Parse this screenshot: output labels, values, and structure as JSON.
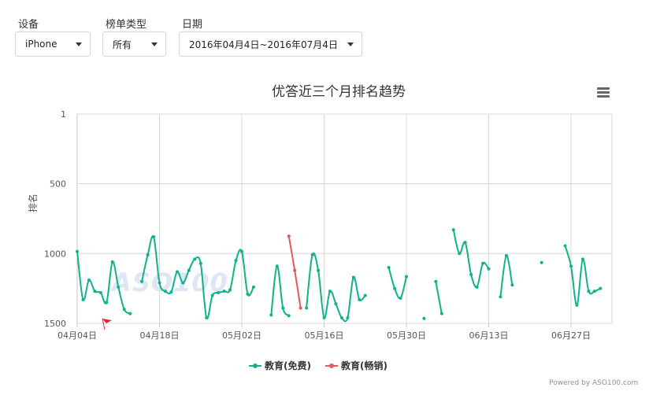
{
  "filters": {
    "device": {
      "label": "设备",
      "value": "iPhone"
    },
    "chart_type": {
      "label": "榜单类型",
      "value": "所有"
    },
    "date": {
      "label": "日期",
      "value": "2016年04月4日~2016年07月4日"
    }
  },
  "watermark": "ASO100",
  "credits": "Powered by ASO100.com",
  "colors": {
    "series_free": "#0fb389",
    "series_paid": "#e8565a",
    "grid": "#d8d8d8"
  },
  "chart_data": {
    "type": "line",
    "title": "优答近三个月排名趋势",
    "ylabel": "排名",
    "y_reversed": true,
    "ylim": [
      1,
      1500
    ],
    "yticks": [
      "1",
      "500",
      "1000",
      "1500"
    ],
    "xticks": [
      "04月04日",
      "04月18日",
      "05月02日",
      "05月16日",
      "05月30日",
      "06月13日",
      "06月27日"
    ],
    "x_start": "04月04日",
    "x_end": "07月04日",
    "grid": true,
    "legend_position": "bottom",
    "series": [
      {
        "name": "教育(免费)",
        "color": "#0fb389",
        "segments": [
          [
            [
              0,
              985
            ],
            [
              1,
              1330
            ],
            [
              2,
              1190
            ],
            [
              3,
              1270
            ],
            [
              4,
              1280
            ],
            [
              5,
              1350
            ],
            [
              6,
              1060
            ],
            [
              7,
              1240
            ],
            [
              8,
              1400
            ],
            [
              9,
              1430
            ]
          ],
          [
            [
              11,
              1200
            ],
            [
              12,
              1010
            ],
            [
              13,
              880
            ],
            [
              14,
              1210
            ],
            [
              15,
              1270
            ],
            [
              16,
              1275
            ],
            [
              17,
              1130
            ],
            [
              18,
              1210
            ],
            [
              19,
              1120
            ],
            [
              20,
              1040
            ],
            [
              21,
              1070
            ],
            [
              22,
              1460
            ],
            [
              23,
              1300
            ],
            [
              24,
              1280
            ],
            [
              25,
              1270
            ],
            [
              26,
              1260
            ],
            [
              27,
              1050
            ],
            [
              28,
              985
            ],
            [
              29,
              1290
            ],
            [
              30,
              1240
            ]
          ],
          [
            [
              33,
              1440
            ],
            [
              34,
              1090
            ],
            [
              35,
              1390
            ],
            [
              36,
              1445
            ]
          ],
          [
            [
              39,
              1390
            ],
            [
              40,
              1010
            ],
            [
              41,
              1120
            ],
            [
              42,
              1460
            ],
            [
              43,
              1270
            ],
            [
              44,
              1360
            ],
            [
              45,
              1460
            ],
            [
              46,
              1460
            ],
            [
              47,
              1170
            ],
            [
              48,
              1330
            ],
            [
              49,
              1300
            ]
          ],
          [
            [
              53,
              1100
            ],
            [
              54,
              1250
            ],
            [
              55,
              1320
            ],
            [
              56,
              1165
            ]
          ],
          [
            [
              59,
              1465
            ]
          ],
          [
            [
              61,
              1200
            ],
            [
              62,
              1430
            ]
          ],
          [
            [
              64,
              830
            ],
            [
              65,
              1000
            ],
            [
              66,
              920
            ],
            [
              67,
              1150
            ],
            [
              68,
              1240
            ],
            [
              69,
              1070
            ],
            [
              70,
              1110
            ]
          ],
          [
            [
              72,
              1310
            ],
            [
              73,
              1015
            ],
            [
              74,
              1225
            ]
          ],
          [
            [
              79,
              1065
            ]
          ],
          [
            [
              83,
              945
            ],
            [
              84,
              1090
            ],
            [
              85,
              1370
            ],
            [
              86,
              1040
            ],
            [
              87,
              1270
            ],
            [
              88,
              1270
            ],
            [
              89,
              1250
            ]
          ]
        ]
      },
      {
        "name": "教育(畅销)",
        "color": "#e8565a",
        "segments": [
          [
            [
              36,
              875
            ],
            [
              37,
              1120
            ],
            [
              38,
              1390
            ]
          ]
        ]
      }
    ]
  }
}
